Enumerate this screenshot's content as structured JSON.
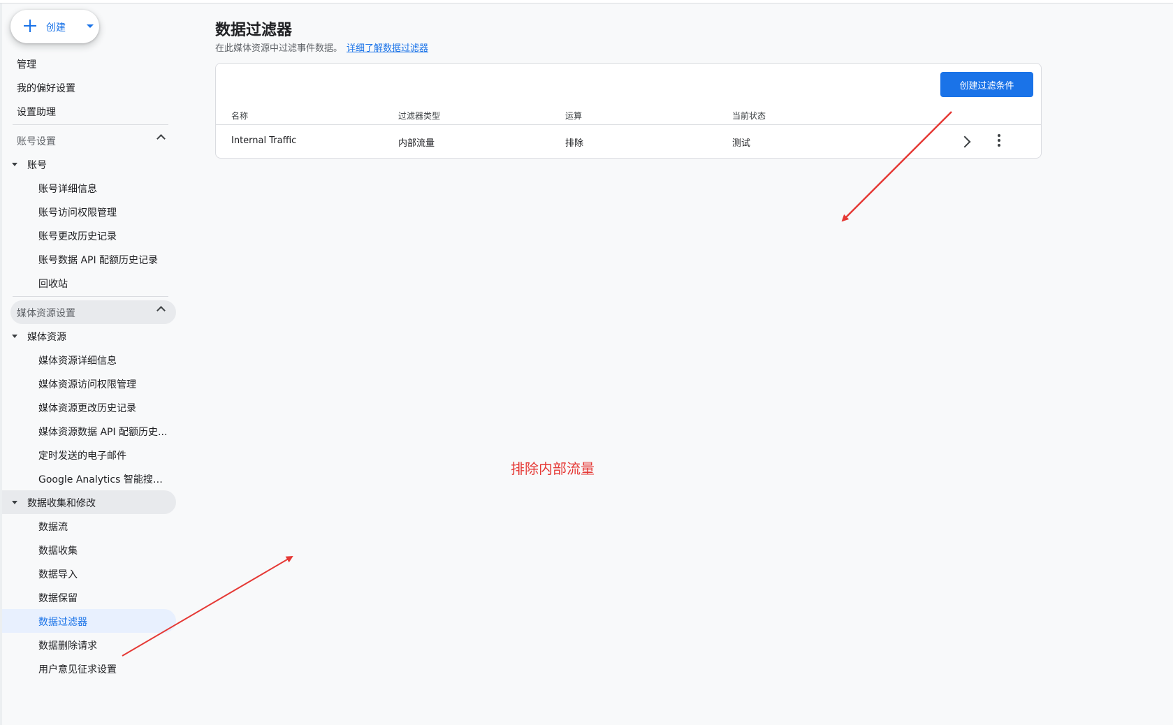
{
  "create_button": {
    "label": "创建"
  },
  "top_nav": [
    "管理",
    "我的偏好设置",
    "设置助理"
  ],
  "account_section": {
    "header": "账号设置",
    "group": "账号",
    "items": [
      "账号详细信息",
      "账号访问权限管理",
      "账号更改历史记录",
      "账号数据 API 配额历史记录",
      "回收站"
    ]
  },
  "property_section": {
    "header": "媒体资源设置",
    "group": "媒体资源",
    "items": [
      "媒体资源详细信息",
      "媒体资源访问权限管理",
      "媒体资源更改历史记录",
      "媒体资源数据 API 配额历史...",
      "定时发送的电子邮件",
      "Google Analytics 智能搜索..."
    ]
  },
  "data_section": {
    "group": "数据收集和修改",
    "items": [
      "数据流",
      "数据收集",
      "数据导入",
      "数据保留",
      "数据过滤器",
      "数据删除请求",
      "用户意见征求设置"
    ],
    "active": "数据过滤器"
  },
  "page": {
    "title": "数据过滤器",
    "description": "在此媒体资源中过滤事件数据。",
    "learn_more": "详细了解数据过滤器"
  },
  "table": {
    "create_label": "创建过滤条件",
    "columns": [
      "名称",
      "过滤器类型",
      "运算",
      "当前状态"
    ],
    "rows": [
      {
        "name": "Internal Traffic",
        "type": "内部流量",
        "operation": "排除",
        "status": "测试"
      }
    ]
  },
  "annotation": {
    "text": "排除内部流量",
    "color": "#e53935"
  },
  "colors": {
    "accent": "#1a73e8",
    "active_bg": "#e8f0fe"
  }
}
